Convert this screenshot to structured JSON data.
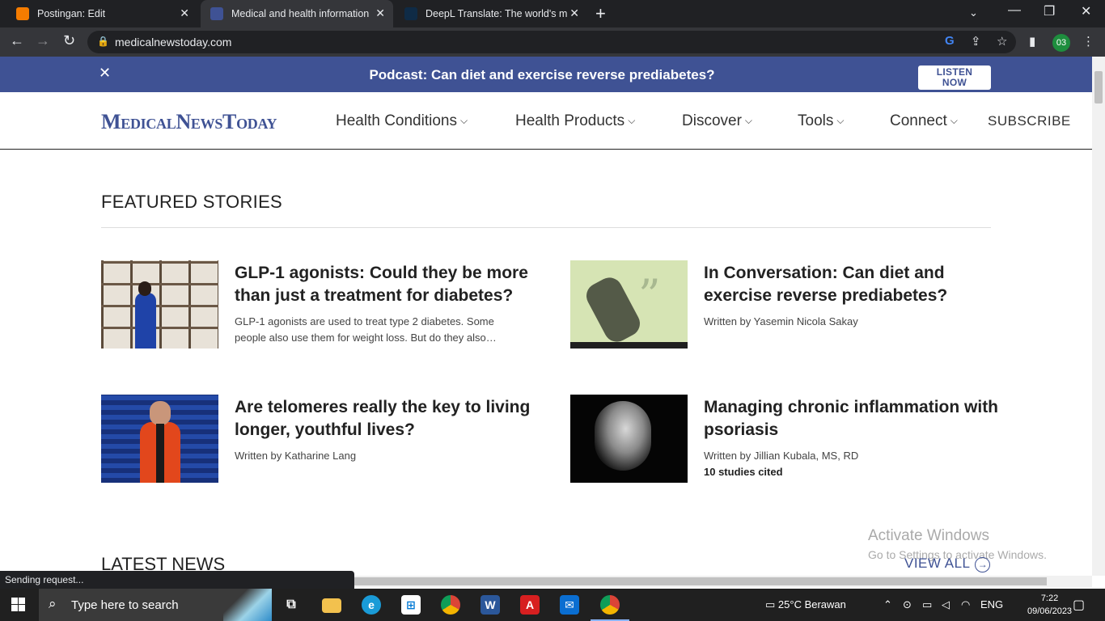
{
  "browser": {
    "tabs": [
      {
        "title": "Postingan: Edit",
        "favicon_color": "#f57c00"
      },
      {
        "title": "Medical and health information",
        "favicon_color": "#3f5294"
      },
      {
        "title": "DeepL Translate: The world's most",
        "favicon_color": "#0f2b46"
      }
    ],
    "url": "medicalnewstoday.com",
    "profile": "03",
    "status": "Sending request..."
  },
  "banner": {
    "close": "✕",
    "text": "Podcast: Can diet and exercise reverse prediabetes?",
    "listen_line1": "LISTEN",
    "listen_line2": "NOW"
  },
  "site": {
    "logo": "MedicalNewsToday",
    "nav": [
      "Health Conditions",
      "Health Products",
      "Discover",
      "Tools",
      "Connect"
    ],
    "subscribe": "SUBSCRIBE",
    "brand_color": "#3f5294"
  },
  "featured": {
    "heading": "FEATURED STORIES",
    "stories": [
      {
        "title": "GLP-1 agonists: Could they be more than just a treatment for diabetes?",
        "meta": "GLP-1 agonists are used to treat type 2 diabetes. Some people also use them for weight loss. But do they also…",
        "cited": ""
      },
      {
        "title": "In Conversation: Can diet and exercise reverse prediabetes?",
        "meta": "Written by Yasemin Nicola Sakay",
        "cited": ""
      },
      {
        "title": "Are telomeres really the key to living longer, youthful lives?",
        "meta": "Written by Katharine Lang",
        "cited": ""
      },
      {
        "title": "Managing chronic inflammation with psoriasis",
        "meta": "Written by Jillian Kubala, MS, RD",
        "cited": "10 studies cited"
      }
    ]
  },
  "latest": {
    "heading": "LATEST NEWS",
    "view_all": "VIEW ALL"
  },
  "watermark": {
    "line1": "Activate Windows",
    "line2": "Go to Settings to activate Windows."
  },
  "taskbar": {
    "search_placeholder": "Type here to search",
    "weather": "25°C  Berawan",
    "lang": "ENG",
    "time": "7:22",
    "date": "09/06/2023"
  }
}
